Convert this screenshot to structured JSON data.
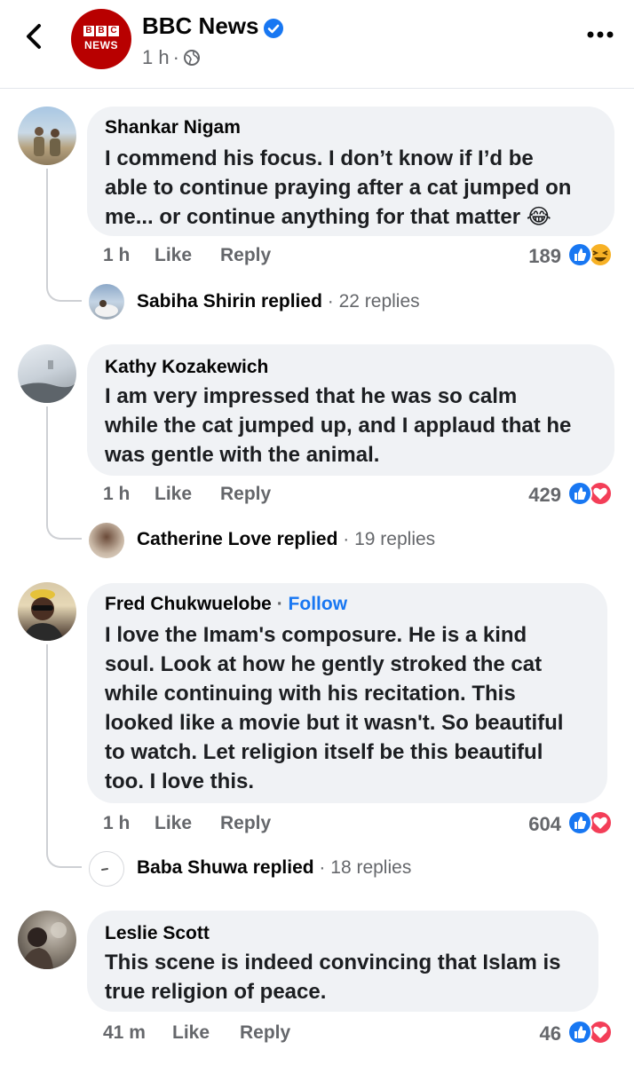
{
  "header": {
    "logo_top": "BBC",
    "logo_bottom": "NEWS",
    "page_name": "BBC News",
    "time": "1 h",
    "separator": "·"
  },
  "comments": [
    {
      "author": "Shankar Nigam",
      "text_lines": [
        "I commend his focus. I don’t know if I’d be",
        "able to continue praying after a cat jumped on",
        "me... or continue anything for that matter 😂"
      ],
      "time": "1 h",
      "like": "Like",
      "reply": "Reply",
      "reaction_count": "189",
      "reactions": [
        "like",
        "haha"
      ],
      "reply_preview": {
        "name": "Sabiha Shirin",
        "replied": "replied",
        "sep": "·",
        "count": "22 replies"
      }
    },
    {
      "author": "Kathy Kozakewich",
      "text_lines": [
        "I am very impressed that he was so calm",
        "while the cat jumped up, and I applaud that he",
        "was gentle with the animal."
      ],
      "time": "1 h",
      "like": "Like",
      "reply": "Reply",
      "reaction_count": "429",
      "reactions": [
        "like",
        "love"
      ],
      "reply_preview": {
        "name": "Catherine Love",
        "replied": "replied",
        "sep": "·",
        "count": "19 replies"
      }
    },
    {
      "author": "Fred Chukwuelobe",
      "follow_sep": "·",
      "follow": "Follow",
      "text_lines": [
        "I love the Imam's composure. He is a kind",
        "soul. Look at how he gently stroked the cat",
        "while continuing with his recitation. This",
        "looked like a movie but it wasn't. So beautiful",
        "to watch. Let religion itself be this beautiful",
        "too. I love this."
      ],
      "time": "1 h",
      "like": "Like",
      "reply": "Reply",
      "reaction_count": "604",
      "reactions": [
        "like",
        "love"
      ],
      "reply_preview": {
        "name": "Baba Shuwa",
        "replied": "replied",
        "sep": "·",
        "count": "18 replies"
      }
    },
    {
      "author": "Leslie Scott",
      "text_lines": [
        "This scene is indeed convincing that Islam is",
        "true religion of peace."
      ],
      "time": "41 m",
      "like": "Like",
      "reply": "Reply",
      "reaction_count": "46",
      "reactions": [
        "like",
        "love"
      ]
    }
  ],
  "colors": {
    "accent": "#1877f2",
    "bubble": "#f0f2f5",
    "muted": "#65676b",
    "bbc_red": "#b80000",
    "love": "#f33e58",
    "haha": "#f7b125"
  }
}
